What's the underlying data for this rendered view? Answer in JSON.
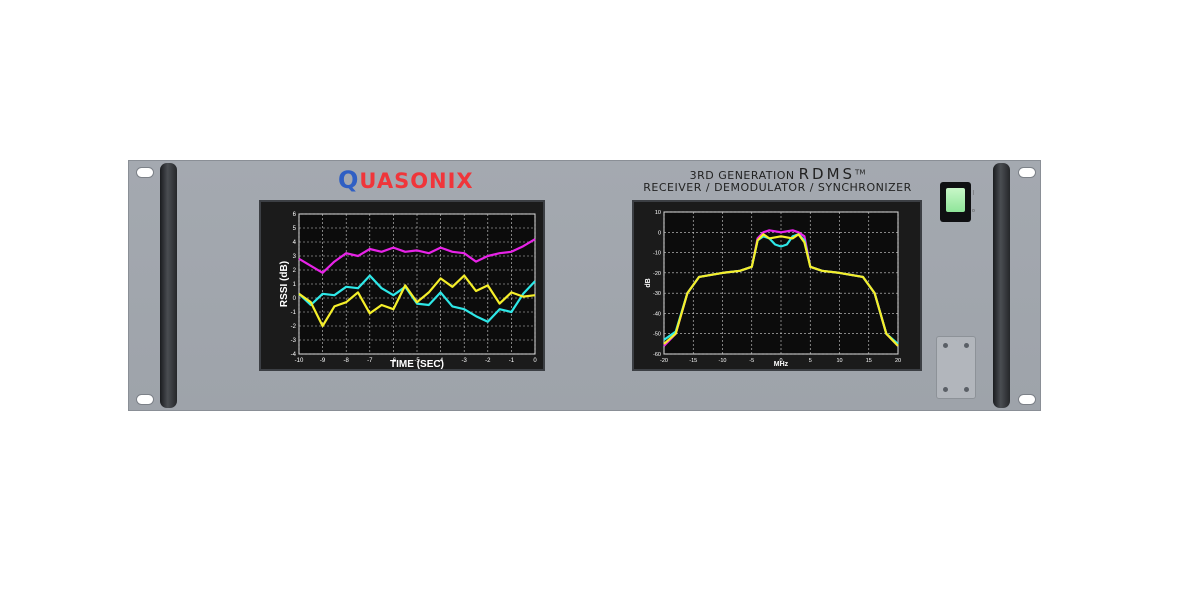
{
  "brand": {
    "logo_first": "Q",
    "logo_rest": "UASONIX"
  },
  "heading": {
    "line1_prefix": "3RD GENERATION",
    "line1_product": "RDMS",
    "line1_tm": "TM",
    "line2": "RECEIVER / DEMODULATOR / SYNCHRONIZER"
  },
  "colors": {
    "magenta": "#e823e8",
    "cyan": "#2ee8e8",
    "yellow": "#f5ef2a",
    "panel": "#a2a7ae"
  },
  "chart_data": [
    {
      "type": "line",
      "title": "",
      "xlabel": "TIME (SEC)",
      "ylabel": "RSSI (dB)",
      "xlim": [
        -10,
        0
      ],
      "ylim": [
        -4,
        6
      ],
      "xticks": [
        "-10",
        "-9",
        "-8",
        "-7",
        "-6",
        "-5",
        "-4",
        "-3",
        "-2",
        "-1",
        "0"
      ],
      "yticks": [
        "6",
        "5",
        "4",
        "3",
        "2",
        "1",
        "0",
        "-1",
        "-2",
        "-3",
        "-4"
      ],
      "grid": true,
      "series": [
        {
          "color": "#e823e8",
          "x": [
            -10,
            -9.5,
            -9,
            -8.5,
            -8,
            -7.5,
            -7,
            -6.5,
            -6,
            -5.5,
            -5,
            -4.5,
            -4,
            -3.5,
            -3,
            -2.5,
            -2,
            -1.5,
            -1,
            -0.5,
            0
          ],
          "y": [
            2.8,
            2.3,
            1.8,
            2.6,
            3.2,
            3.0,
            3.5,
            3.3,
            3.6,
            3.3,
            3.4,
            3.2,
            3.6,
            3.3,
            3.2,
            2.6,
            3.0,
            3.2,
            3.3,
            3.7,
            4.2
          ]
        },
        {
          "color": "#2ee8e8",
          "x": [
            -10,
            -9.5,
            -9,
            -8.5,
            -8,
            -7.5,
            -7,
            -6.5,
            -6,
            -5.5,
            -5,
            -4.5,
            -4,
            -3.5,
            -3,
            -2.5,
            -2,
            -1.5,
            -1,
            -0.5,
            0
          ],
          "y": [
            0.3,
            -0.5,
            0.3,
            0.2,
            0.8,
            0.7,
            1.6,
            0.7,
            0.2,
            0.8,
            -0.4,
            -0.5,
            0.4,
            -0.6,
            -0.8,
            -1.3,
            -1.7,
            -0.8,
            -1.0,
            0.3,
            1.2
          ]
        },
        {
          "color": "#f5ef2a",
          "x": [
            -10,
            -9.5,
            -9,
            -8.5,
            -8,
            -7.5,
            -7,
            -6.5,
            -6,
            -5.5,
            -5,
            -4.5,
            -4,
            -3.5,
            -3,
            -2.5,
            -2,
            -1.5,
            -1,
            -0.5,
            0
          ],
          "y": [
            0.3,
            -0.3,
            -2.0,
            -0.6,
            -0.3,
            0.4,
            -1.1,
            -0.5,
            -0.8,
            0.9,
            -0.3,
            0.4,
            1.4,
            0.8,
            1.6,
            0.5,
            0.9,
            -0.4,
            0.4,
            0.1,
            0.2
          ]
        }
      ]
    },
    {
      "type": "line",
      "title": "",
      "xlabel": "MHz",
      "ylabel": "dB",
      "xlim": [
        -20,
        20
      ],
      "ylim": [
        -60,
        10
      ],
      "xticks": [
        "-20",
        "-15",
        "-10",
        "-5",
        "0",
        "5",
        "10",
        "15",
        "20"
      ],
      "yticks": [
        "10",
        "0",
        "-10",
        "-20",
        "-30",
        "-40",
        "-50",
        "-60"
      ],
      "grid": true,
      "series": [
        {
          "color": "#e823e8",
          "x": [
            -20,
            -18,
            -16,
            -14,
            -12,
            -10,
            -7,
            -5,
            -4,
            -3,
            -2,
            0,
            2,
            3,
            4,
            5,
            7,
            10,
            12,
            14,
            16,
            18,
            20
          ],
          "y": [
            -56,
            -50,
            -30,
            -22,
            -21,
            -20,
            -19,
            -17,
            -3,
            0,
            1,
            0,
            1,
            0,
            -2,
            -17,
            -19,
            -20,
            -21,
            -22,
            -30,
            -50,
            -56
          ]
        },
        {
          "color": "#2ee8e8",
          "x": [
            -20,
            -18,
            -16,
            -14,
            -12,
            -10,
            -7,
            -5,
            -4,
            -3,
            -2,
            -1,
            0,
            1,
            2,
            3,
            4,
            5,
            7,
            10,
            12,
            14,
            16,
            18,
            20
          ],
          "y": [
            -53,
            -49,
            -30,
            -22,
            -21,
            -20,
            -19,
            -17,
            -4,
            -2,
            -3,
            -6,
            -7,
            -6,
            -2,
            -1,
            -4,
            -17,
            -19,
            -20,
            -21,
            -22,
            -30,
            -50,
            -55
          ]
        },
        {
          "color": "#f5ef2a",
          "x": [
            -20,
            -18,
            -16,
            -14,
            -12,
            -10,
            -7,
            -5,
            -4,
            -3,
            -2,
            0,
            2,
            3,
            4,
            5,
            7,
            10,
            12,
            14,
            16,
            18,
            20
          ],
          "y": [
            -55,
            -50,
            -30,
            -22,
            -21,
            -20,
            -19,
            -17,
            -4,
            -1,
            -3,
            -2,
            -3,
            -1,
            -5,
            -17,
            -19,
            -20,
            -21,
            -22,
            -30,
            -50,
            -56
          ]
        }
      ]
    }
  ]
}
